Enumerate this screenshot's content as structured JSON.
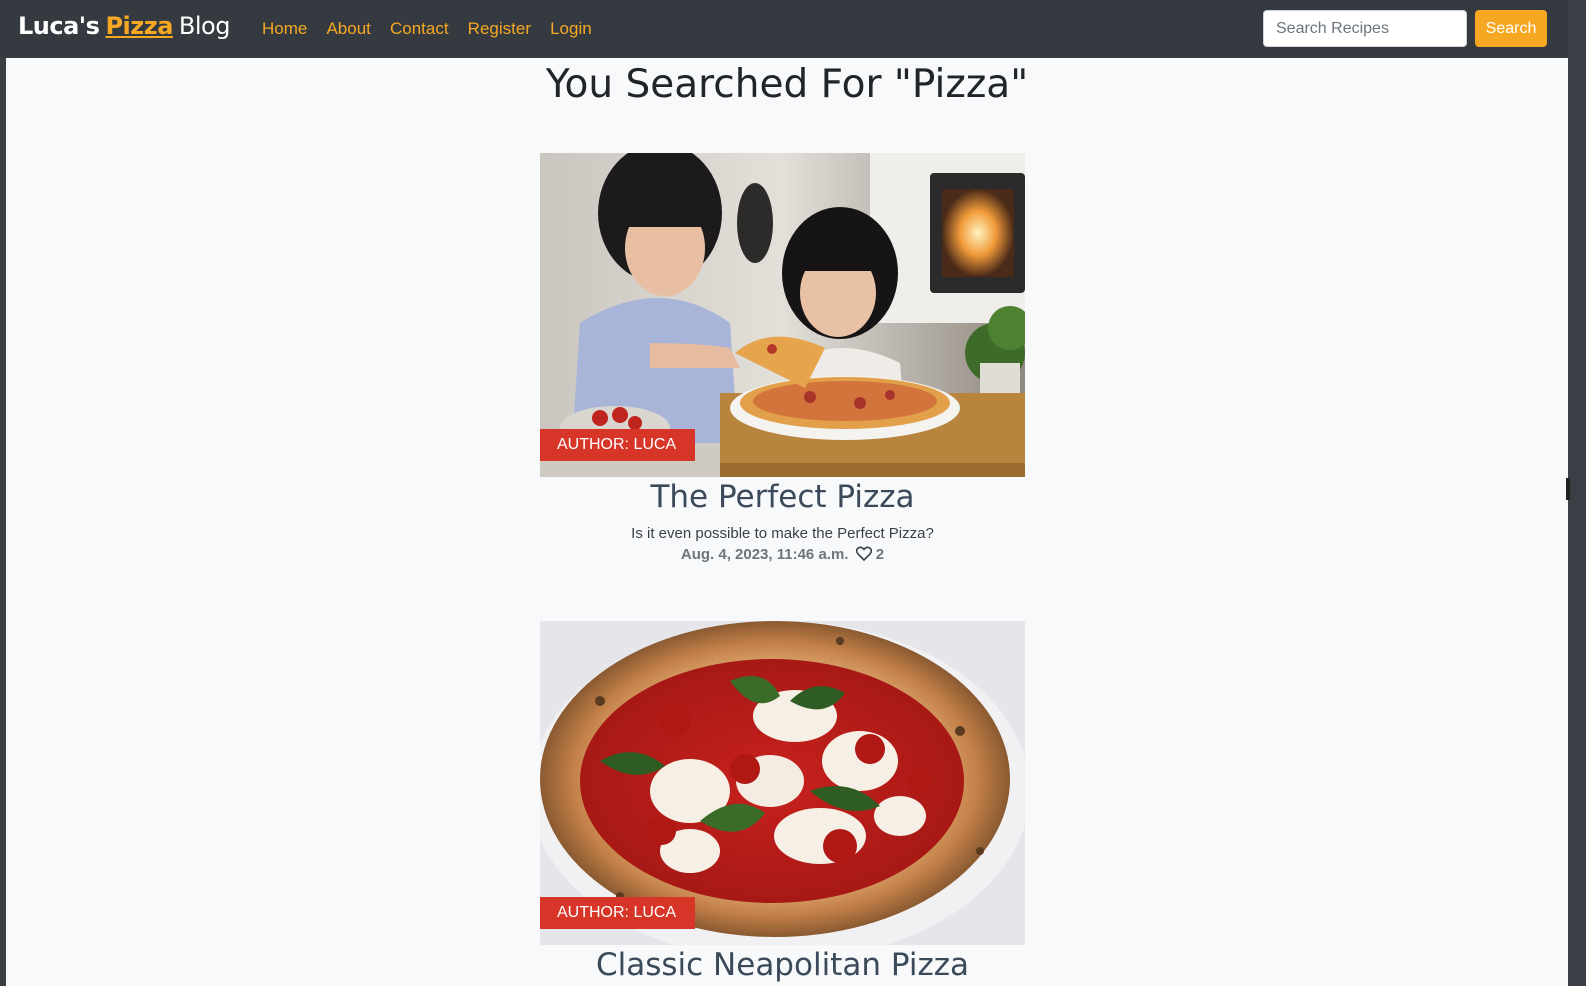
{
  "brand": {
    "part1": "Luca's",
    "part2": "Pizza",
    "part3": "Blog"
  },
  "nav": {
    "items": [
      {
        "label": "Home"
      },
      {
        "label": "About"
      },
      {
        "label": "Contact"
      },
      {
        "label": "Register"
      },
      {
        "label": "Login"
      }
    ]
  },
  "search": {
    "placeholder": "Search Recipes",
    "value": "",
    "button_label": "Search"
  },
  "colors": {
    "accent": "#f6a823",
    "navbar": "#343a40",
    "badge": "#d73527",
    "page_bg": "#f8f9fa"
  },
  "main": {
    "title": "You Searched For \"Pizza\"",
    "posts": [
      {
        "author_badge": "AUTHOR: LUCA",
        "title": "The Perfect Pizza",
        "excerpt": "Is it even possible to make the Perfect Pizza?",
        "date": "Aug. 4, 2023, 11:46 a.m.",
        "likes": "2",
        "image": "two-girls-eating-pizza-photo"
      },
      {
        "author_badge": "AUTHOR: LUCA",
        "title": "Classic Neapolitan Pizza",
        "image": "margherita-pizza-photo"
      }
    ]
  }
}
